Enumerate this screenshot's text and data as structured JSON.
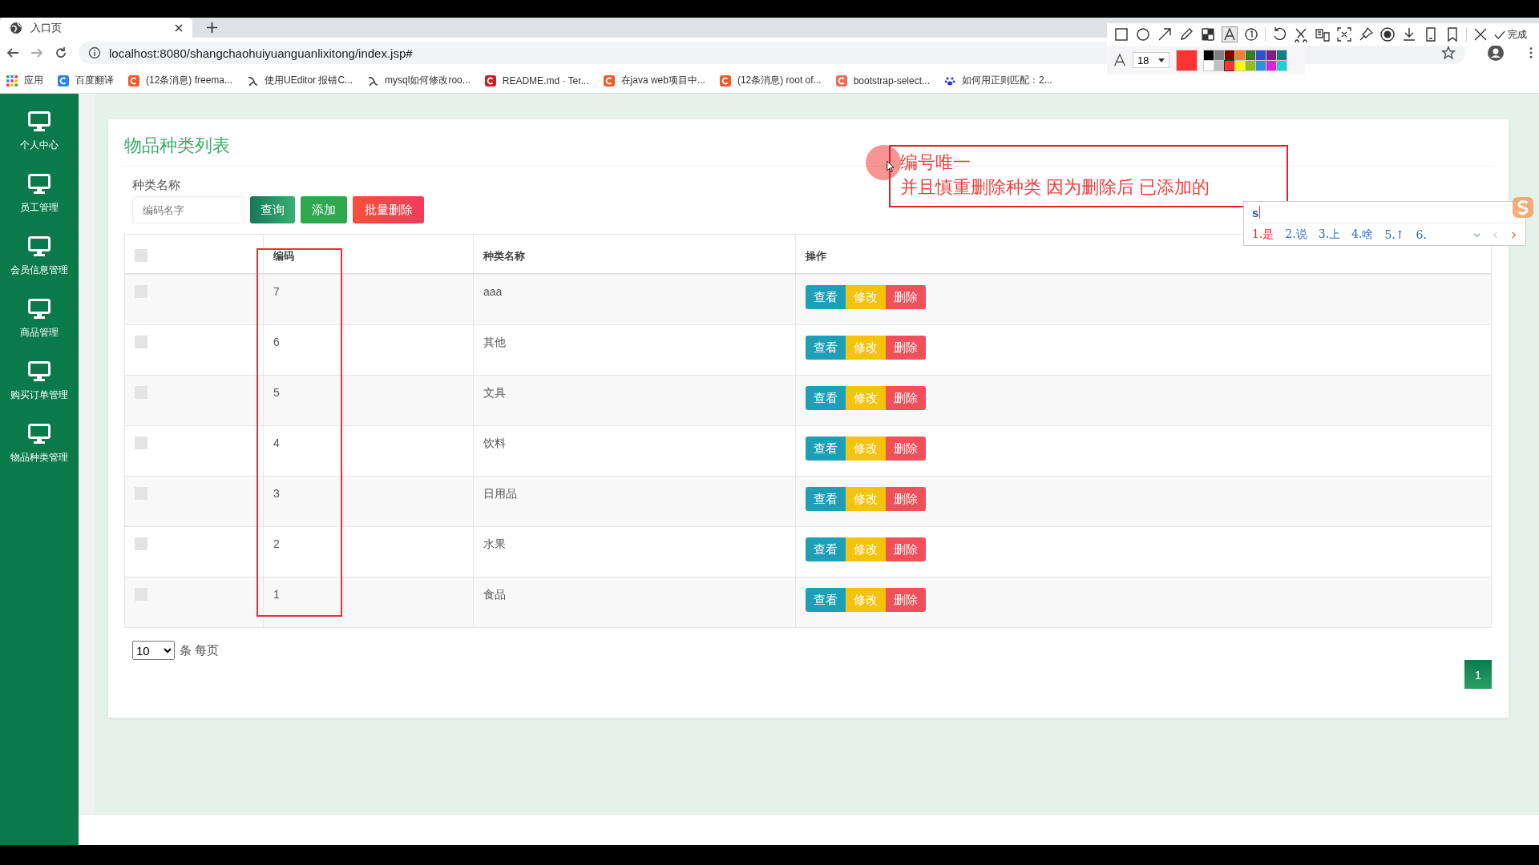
{
  "browser": {
    "tab_title": "入口页",
    "url": "localhost:8080/shangchaohuiyuanguanlixitong/index.jsp#",
    "bookmarks": [
      {
        "label": "应用",
        "kind": "apps"
      },
      {
        "label": "百度翻译",
        "kind": "translate"
      },
      {
        "label": "(12条消息) freema...",
        "kind": "csdn"
      },
      {
        "label": "使用UEditor 报错C...",
        "kind": "yuque"
      },
      {
        "label": "mysql如何修改roo...",
        "kind": "yuque"
      },
      {
        "label": "README.md · Ter...",
        "kind": "gitee"
      },
      {
        "label": "在java web项目中...",
        "kind": "csdn"
      },
      {
        "label": "(12条消息) root of...",
        "kind": "csdn"
      },
      {
        "label": "bootstrap-select...",
        "kind": "jianshu"
      },
      {
        "label": "如何用正则匹配：2...",
        "kind": "baidu"
      }
    ]
  },
  "capture_toolbar": {
    "tools": [
      {
        "kind": "rect",
        "selected": false
      },
      {
        "kind": "circle",
        "selected": false
      },
      {
        "kind": "arrow",
        "selected": false
      },
      {
        "kind": "pen",
        "selected": false
      },
      {
        "kind": "mosaic",
        "selected": false
      },
      {
        "kind": "text",
        "selected": true
      },
      {
        "kind": "number",
        "selected": false
      },
      {
        "kind": "undo",
        "selected": false
      },
      {
        "kind": "cut",
        "selected": false
      },
      {
        "kind": "ocr",
        "selected": false
      },
      {
        "kind": "scan",
        "selected": false
      },
      {
        "kind": "pin",
        "selected": false
      },
      {
        "kind": "record",
        "selected": false
      },
      {
        "kind": "download",
        "selected": false
      },
      {
        "kind": "phone",
        "selected": false
      },
      {
        "kind": "bookmark",
        "selected": false
      },
      {
        "kind": "close",
        "selected": false
      }
    ],
    "done_label": "完成",
    "font_size": "18",
    "palette": [
      {
        "color": "#000000",
        "selected": false
      },
      {
        "color": "#808080",
        "selected": false
      },
      {
        "color": "#800000",
        "selected": false
      },
      {
        "color": "#f08030",
        "selected": false
      },
      {
        "color": "#308030",
        "selected": false
      },
      {
        "color": "#3050d0",
        "selected": false
      },
      {
        "color": "#802080",
        "selected": false
      },
      {
        "color": "#108080",
        "selected": false
      },
      {
        "color": "#ffffff",
        "selected": false
      },
      {
        "color": "#c0c0c0",
        "selected": false
      },
      {
        "color": "#ff3333",
        "selected": true
      },
      {
        "color": "#ffff00",
        "selected": false
      },
      {
        "color": "#90c020",
        "selected": false
      },
      {
        "color": "#3090e0",
        "selected": false
      },
      {
        "color": "#e020e0",
        "selected": false
      },
      {
        "color": "#20d0d0",
        "selected": false
      }
    ]
  },
  "sidebar": {
    "items": [
      {
        "label": "个人中心"
      },
      {
        "label": "员工管理"
      },
      {
        "label": "会员信息管理"
      },
      {
        "label": "商品管理"
      },
      {
        "label": "购买订单管理"
      },
      {
        "label": "物品种类管理"
      }
    ]
  },
  "page": {
    "title": "物品种类列表",
    "search_label": "种类名称",
    "search": {
      "placeholder": "编码名字"
    },
    "buttons": [
      {
        "label": "查询",
        "kind": "query"
      },
      {
        "label": "添加",
        "kind": "add"
      },
      {
        "label": "批量删除",
        "kind": "delete"
      }
    ],
    "table": {
      "select_all_checked": false,
      "columns": [
        "编码",
        "种类名称",
        "操作"
      ],
      "rows": [
        {
          "checked": false,
          "code": "7",
          "name": "aaa",
          "actions": [
            {
              "label": "查看",
              "kind": "view"
            },
            {
              "label": "修改",
              "kind": "edit"
            },
            {
              "label": "删除",
              "kind": "delete"
            }
          ]
        },
        {
          "checked": false,
          "code": "6",
          "name": "其他",
          "actions": [
            {
              "label": "查看",
              "kind": "view"
            },
            {
              "label": "修改",
              "kind": "edit"
            },
            {
              "label": "删除",
              "kind": "delete"
            }
          ]
        },
        {
          "checked": false,
          "code": "5",
          "name": "文具",
          "actions": [
            {
              "label": "查看",
              "kind": "view"
            },
            {
              "label": "修改",
              "kind": "edit"
            },
            {
              "label": "删除",
              "kind": "delete"
            }
          ]
        },
        {
          "checked": false,
          "code": "4",
          "name": "饮料",
          "actions": [
            {
              "label": "查看",
              "kind": "view"
            },
            {
              "label": "修改",
              "kind": "edit"
            },
            {
              "label": "删除",
              "kind": "delete"
            }
          ]
        },
        {
          "checked": false,
          "code": "3",
          "name": "日用品",
          "actions": [
            {
              "label": "查看",
              "kind": "view"
            },
            {
              "label": "修改",
              "kind": "edit"
            },
            {
              "label": "删除",
              "kind": "delete"
            }
          ]
        },
        {
          "checked": false,
          "code": "2",
          "name": "水果",
          "actions": [
            {
              "label": "查看",
              "kind": "view"
            },
            {
              "label": "修改",
              "kind": "edit"
            },
            {
              "label": "删除",
              "kind": "delete"
            }
          ]
        },
        {
          "checked": false,
          "code": "1",
          "name": "食品",
          "actions": [
            {
              "label": "查看",
              "kind": "view"
            },
            {
              "label": "修改",
              "kind": "edit"
            },
            {
              "label": "删除",
              "kind": "delete"
            }
          ]
        }
      ]
    },
    "pagination": {
      "page_size": "10",
      "per_page_label": "条 每页",
      "pages": [
        {
          "label": "1",
          "selected": true
        }
      ]
    }
  },
  "annotation": {
    "lines": [
      "编号唯一",
      "并且慎重删除种类  因为删除后 已添加的"
    ]
  },
  "ime": {
    "input": "s",
    "candidates": [
      "1.是",
      "2.说",
      "3.上",
      "4.啥",
      "5.↑",
      "6."
    ]
  }
}
